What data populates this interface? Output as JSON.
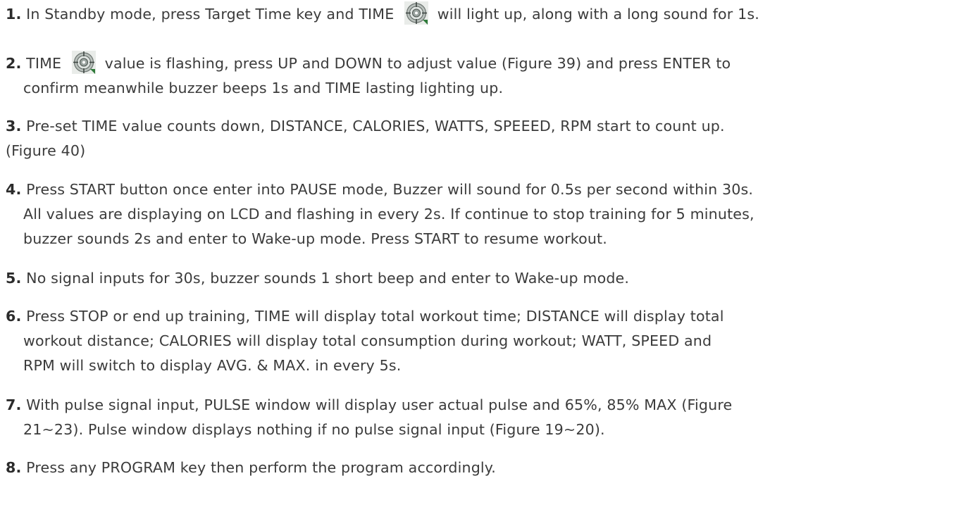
{
  "steps": [
    {
      "num": "1.",
      "lines": [
        {
          "before": "In Standby mode, press Target Time key and TIME",
          "icon": "target-time-icon",
          "after": "will light up, along with a long sound for 1s."
        }
      ]
    },
    {
      "num": "2.",
      "lines": [
        {
          "before": "TIME",
          "icon": "target-time-icon",
          "after": "value is flashing, press UP and DOWN to adjust value (Figure 39) and press ENTER to"
        },
        {
          "text": "confirm meanwhile buzzer beeps 1s and TIME lasting lighting up."
        }
      ]
    },
    {
      "num": "3.",
      "lines": [
        {
          "text": "Pre-set TIME value counts down, DISTANCE, CALORIES, WATTS, SPEEED, RPM start to count up."
        },
        {
          "text": "(Figure 40)"
        }
      ]
    },
    {
      "num": "4.",
      "lines": [
        {
          "text": "Press START button once enter into PAUSE mode, Buzzer will sound for 0.5s per second within 30s."
        },
        {
          "text": "All values are displaying on LCD and flashing in every 2s. If continue to stop training for 5 minutes,"
        },
        {
          "text": "buzzer sounds 2s and enter to Wake-up mode. Press START to resume workout."
        }
      ]
    },
    {
      "num": "5.",
      "lines": [
        {
          "text": "No signal inputs for 30s, buzzer sounds 1 short beep and enter to Wake-up mode."
        }
      ]
    },
    {
      "num": "6.",
      "lines": [
        {
          "text": "Press STOP or end up training, TIME will display total workout time; DISTANCE will display total"
        },
        {
          "text": "workout distance; CALORIES will display total consumption during workout; WATT, SPEED and"
        },
        {
          "text": "RPM will switch to display AVG. & MAX. in every 5s."
        }
      ]
    },
    {
      "num": "7.",
      "lines": [
        {
          "text": "With pulse signal input, PULSE window will display user actual pulse and 65%, 85% MAX (Figure"
        },
        {
          "text": "21~23). Pulse window displays nothing if no pulse signal input (Figure 19~20)."
        }
      ]
    },
    {
      "num": "8.",
      "lines": [
        {
          "text": "Press any PROGRAM key then perform the program accordingly."
        }
      ]
    }
  ]
}
